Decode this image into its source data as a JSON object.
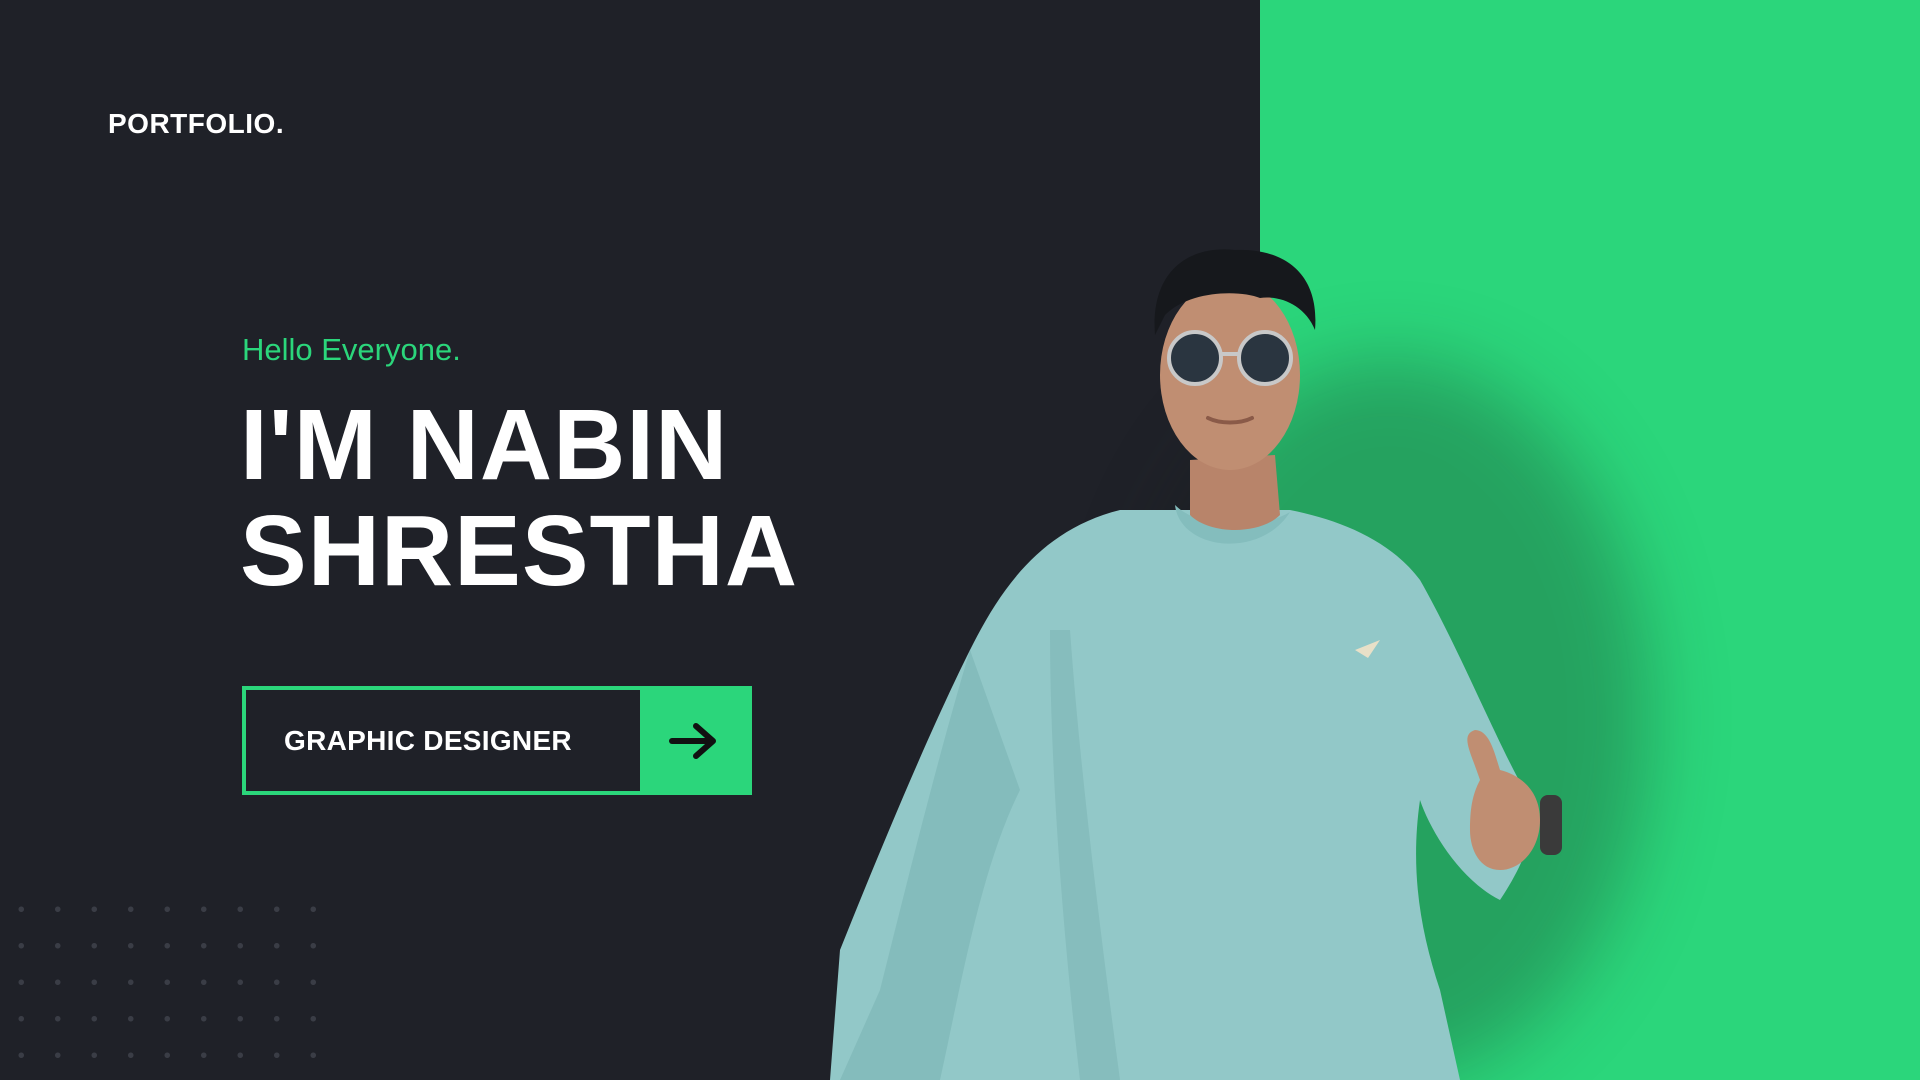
{
  "header": {
    "brand": "PORTFOLIO."
  },
  "hero": {
    "greeting": "Hello Everyone.",
    "headline_line1": "I'M NABIN",
    "headline_line2": "SHRESTHA",
    "cta_label": "GRAPHIC DESIGNER",
    "cta_icon": "arrow-right-icon"
  },
  "visual": {
    "portrait_icon": "person-portrait-illustration",
    "pattern_icon": "dot-grid-pattern"
  },
  "colors": {
    "background": "#1f2128",
    "accent": "#2bd67b",
    "text": "#ffffff",
    "sweater": "#92c8c8"
  }
}
